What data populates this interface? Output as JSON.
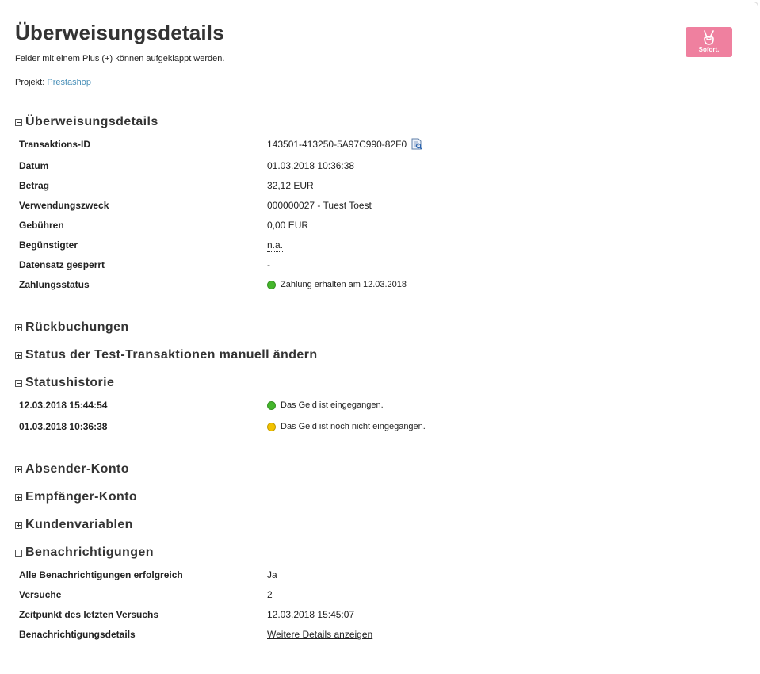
{
  "page": {
    "title": "Überweisungsdetails",
    "hint": "Felder mit einem Plus (+) können aufgeklappt werden.",
    "project_label": "Projekt:",
    "project_link": "Prestashop",
    "logo_text": "Sofort."
  },
  "sections": {
    "details": {
      "heading": "Überweisungsdetails",
      "rows": [
        {
          "label": "Transaktions-ID",
          "value": "143501-413250-5A97C990-82F0"
        },
        {
          "label": "Datum",
          "value": "01.03.2018 10:36:38"
        },
        {
          "label": "Betrag",
          "value": "32,12 EUR"
        },
        {
          "label": "Verwendungszweck",
          "value": "000000027 - Tuest Toest"
        },
        {
          "label": "Gebühren",
          "value": "0,00 EUR"
        },
        {
          "label": "Begünstigter",
          "value": "n.a."
        },
        {
          "label": "Datensatz gesperrt",
          "value": "-"
        },
        {
          "label": "Zahlungsstatus",
          "value": "Zahlung erhalten am 12.03.2018"
        }
      ]
    },
    "rueckbuchungen": {
      "heading": "Rückbuchungen"
    },
    "test_status": {
      "heading": "Status der Test-Transaktionen manuell ändern"
    },
    "statushistorie": {
      "heading": "Statushistorie",
      "rows": [
        {
          "label": "12.03.2018 15:44:54",
          "value": "Das Geld ist eingegangen."
        },
        {
          "label": "01.03.2018 10:36:38",
          "value": "Das Geld ist noch nicht eingegangen."
        }
      ]
    },
    "absender": {
      "heading": "Absender-Konto"
    },
    "empfaenger": {
      "heading": "Empfänger-Konto"
    },
    "kundenvariablen": {
      "heading": "Kundenvariablen"
    },
    "benachrichtigungen": {
      "heading": "Benachrichtigungen",
      "rows": [
        {
          "label": "Alle Benachrichtigungen erfolgreich",
          "value": "Ja"
        },
        {
          "label": "Versuche",
          "value": "2"
        },
        {
          "label": "Zeitpunkt des letzten Versuchs",
          "value": "12.03.2018 15:45:07"
        },
        {
          "label": "Benachrichtigungsdetails",
          "value": "Weitere Details anzeigen"
        }
      ]
    }
  },
  "colors": {
    "status_green": "#44b62b",
    "status_yellow": "#f2c200",
    "logo_pink": "#ef809f",
    "link": "#4a90b8"
  },
  "icons": [
    "collapse-icon",
    "expand-icon",
    "document-icon",
    "status-dot",
    "sofort-hand-icon"
  ]
}
